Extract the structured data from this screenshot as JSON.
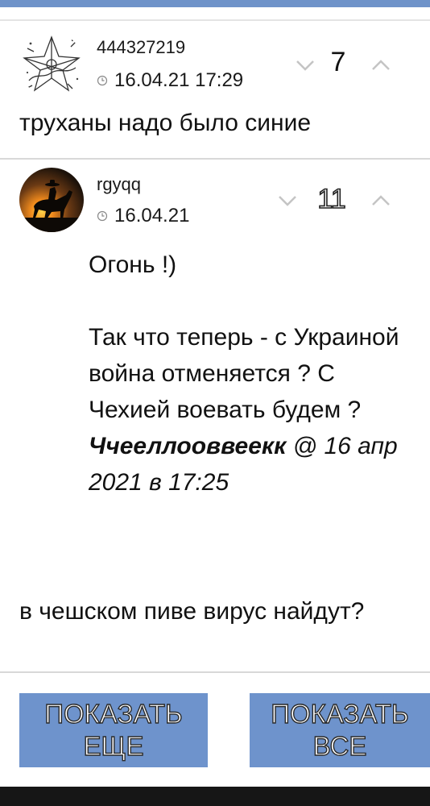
{
  "colors": {
    "accent": "#6e93cc",
    "text": "#111111",
    "divider": "#d8d8d8",
    "bottom_bar": "#161616"
  },
  "comments": [
    {
      "username": "444327219",
      "date": "16.04.21 17:29",
      "score": "7",
      "avatar_icon": "star-sketch-avatar",
      "text": "труханы надо было синие"
    },
    {
      "username": "rgyqq",
      "date": "16.04.21",
      "score": "11",
      "avatar_icon": "cowboy-sunset-avatar",
      "lines": [
        "Огонь !)",
        "Так что теперь - с Украиной война отменяется ? С Чехией воевать будем ?"
      ],
      "quote": {
        "author": "Ччееллооввеекк",
        "meta": " @ 16 апр 2021 в 17:25"
      },
      "reply": "в чешском пиве вирус найдут?"
    }
  ],
  "buttons": {
    "show_more": "ПОКАЗАТЬ ЕЩЕ",
    "show_all": "ПОКАЗАТЬ ВСЕ"
  },
  "icons": {
    "vote_down": "chevron-down-icon",
    "vote_up": "chevron-up-icon",
    "clock": "clock-icon"
  }
}
